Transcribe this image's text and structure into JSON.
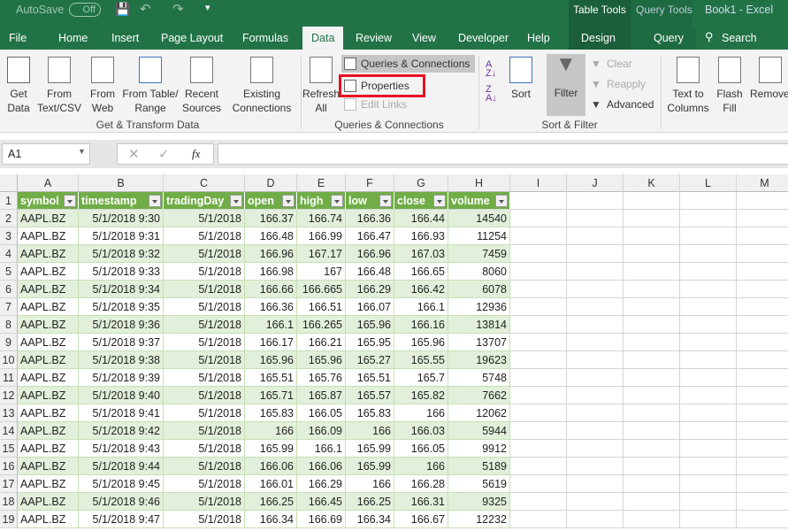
{
  "titlebar": {
    "autosave": "AutoSave",
    "toggle": "Off",
    "table_tools": "Table Tools",
    "query_tools": "Query Tools",
    "title": "Book1  -  Excel"
  },
  "tabs": [
    "File",
    "Home",
    "Insert",
    "Page Layout",
    "Formulas",
    "Data",
    "Review",
    "View",
    "Developer",
    "Help",
    "Design",
    "Query"
  ],
  "search": "Search",
  "ribbon": {
    "get_data": "Get Data",
    "from_text": "From Text/CSV",
    "from_web": "From Web",
    "from_table": "From Table/ Range",
    "recent": "Recent Sources",
    "existing": "Existing Connections",
    "group1": "Get & Transform Data",
    "refresh": "Refresh All",
    "queries": "Queries & Connections",
    "properties": "Properties",
    "edit_links": "Edit Links",
    "group2": "Queries & Connections",
    "sort": "Sort",
    "filter": "Filter",
    "clear": "Clear",
    "reapply": "Reapply",
    "advanced": "Advanced",
    "group3": "Sort & Filter",
    "text_to_columns": "Text to Columns",
    "flash_fill": "Flash Fill",
    "remove_dup": "Remove Duplicates"
  },
  "highlight_color": "#e81123",
  "namebox": "A1",
  "fx": "fx",
  "columns": [
    "A",
    "B",
    "C",
    "D",
    "E",
    "F",
    "G",
    "H",
    "I",
    "J",
    "K",
    "L",
    "M"
  ],
  "headers": [
    "symbol",
    "timestamp",
    "tradingDay",
    "open",
    "high",
    "low",
    "close",
    "volume"
  ],
  "rows": [
    [
      "AAPL.BZ",
      "5/1/2018 9:30",
      "5/1/2018",
      "166.37",
      "166.74",
      "166.36",
      "166.44",
      "14540"
    ],
    [
      "AAPL.BZ",
      "5/1/2018 9:31",
      "5/1/2018",
      "166.48",
      "166.99",
      "166.47",
      "166.93",
      "11254"
    ],
    [
      "AAPL.BZ",
      "5/1/2018 9:32",
      "5/1/2018",
      "166.96",
      "167.17",
      "166.96",
      "167.03",
      "7459"
    ],
    [
      "AAPL.BZ",
      "5/1/2018 9:33",
      "5/1/2018",
      "166.98",
      "167",
      "166.48",
      "166.65",
      "8060"
    ],
    [
      "AAPL.BZ",
      "5/1/2018 9:34",
      "5/1/2018",
      "166.66",
      "166.665",
      "166.29",
      "166.42",
      "6078"
    ],
    [
      "AAPL.BZ",
      "5/1/2018 9:35",
      "5/1/2018",
      "166.36",
      "166.51",
      "166.07",
      "166.1",
      "12936"
    ],
    [
      "AAPL.BZ",
      "5/1/2018 9:36",
      "5/1/2018",
      "166.1",
      "166.265",
      "165.96",
      "166.16",
      "13814"
    ],
    [
      "AAPL.BZ",
      "5/1/2018 9:37",
      "5/1/2018",
      "166.17",
      "166.21",
      "165.95",
      "165.96",
      "13707"
    ],
    [
      "AAPL.BZ",
      "5/1/2018 9:38",
      "5/1/2018",
      "165.96",
      "165.96",
      "165.27",
      "165.55",
      "19623"
    ],
    [
      "AAPL.BZ",
      "5/1/2018 9:39",
      "5/1/2018",
      "165.51",
      "165.76",
      "165.51",
      "165.7",
      "5748"
    ],
    [
      "AAPL.BZ",
      "5/1/2018 9:40",
      "5/1/2018",
      "165.71",
      "165.87",
      "165.57",
      "165.82",
      "7662"
    ],
    [
      "AAPL.BZ",
      "5/1/2018 9:41",
      "5/1/2018",
      "165.83",
      "166.05",
      "165.83",
      "166",
      "12062"
    ],
    [
      "AAPL.BZ",
      "5/1/2018 9:42",
      "5/1/2018",
      "166",
      "166.09",
      "166",
      "166.03",
      "5944"
    ],
    [
      "AAPL.BZ",
      "5/1/2018 9:43",
      "5/1/2018",
      "165.99",
      "166.1",
      "165.99",
      "166.05",
      "9912"
    ],
    [
      "AAPL.BZ",
      "5/1/2018 9:44",
      "5/1/2018",
      "166.06",
      "166.06",
      "165.99",
      "166",
      "5189"
    ],
    [
      "AAPL.BZ",
      "5/1/2018 9:45",
      "5/1/2018",
      "166.01",
      "166.29",
      "166",
      "166.28",
      "5619"
    ],
    [
      "AAPL.BZ",
      "5/1/2018 9:46",
      "5/1/2018",
      "166.25",
      "166.45",
      "166.25",
      "166.31",
      "9325"
    ],
    [
      "AAPL.BZ",
      "5/1/2018 9:47",
      "5/1/2018",
      "166.34",
      "166.69",
      "166.34",
      "166.67",
      "12232"
    ]
  ]
}
